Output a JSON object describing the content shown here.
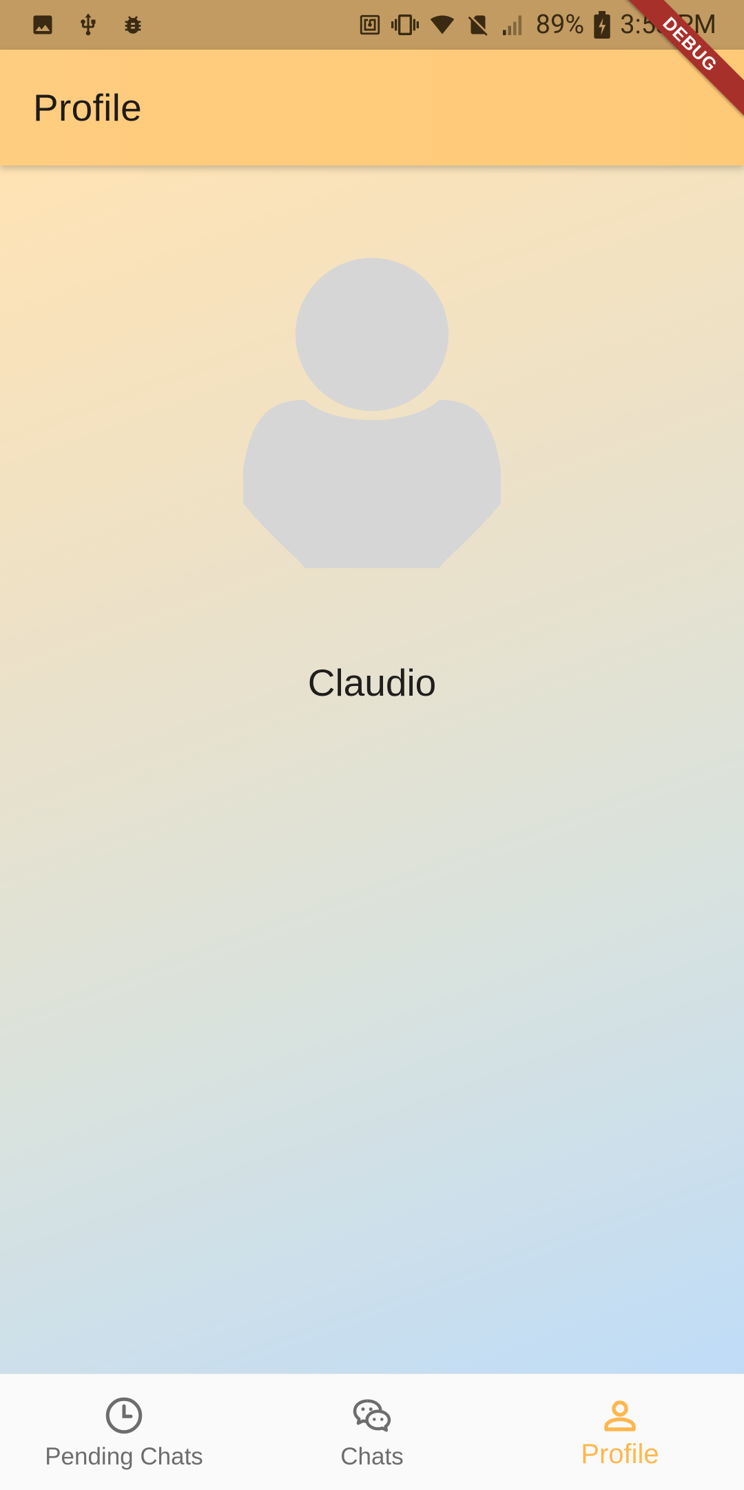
{
  "status_bar": {
    "battery": "89%",
    "time": "3:53 PM",
    "left_icons": [
      "image-icon",
      "usb-icon",
      "bug-icon"
    ],
    "right_icons": [
      "nfc-icon",
      "vibrate-icon",
      "wifi-icon",
      "no-sim-icon",
      "signal-icon",
      "battery-charging-icon"
    ]
  },
  "debug_banner": "DEBUG",
  "app_bar": {
    "title": "Profile"
  },
  "profile": {
    "name": "Claudio",
    "avatar_icon": "person-avatar-icon"
  },
  "bottom_nav": {
    "items": [
      {
        "label": "Pending Chats",
        "icon": "clock-icon",
        "active": false
      },
      {
        "label": "Chats",
        "icon": "chat-bubbles-icon",
        "active": false
      },
      {
        "label": "Profile",
        "icon": "person-icon",
        "active": true
      }
    ]
  },
  "colors": {
    "status_bar": "#c29b62",
    "app_bar": "#ffcd80",
    "accent": "#ffb74d",
    "debug_ribbon": "#a8302a",
    "avatar": "#d6d6d6",
    "inactive": "#6d6d6d"
  }
}
